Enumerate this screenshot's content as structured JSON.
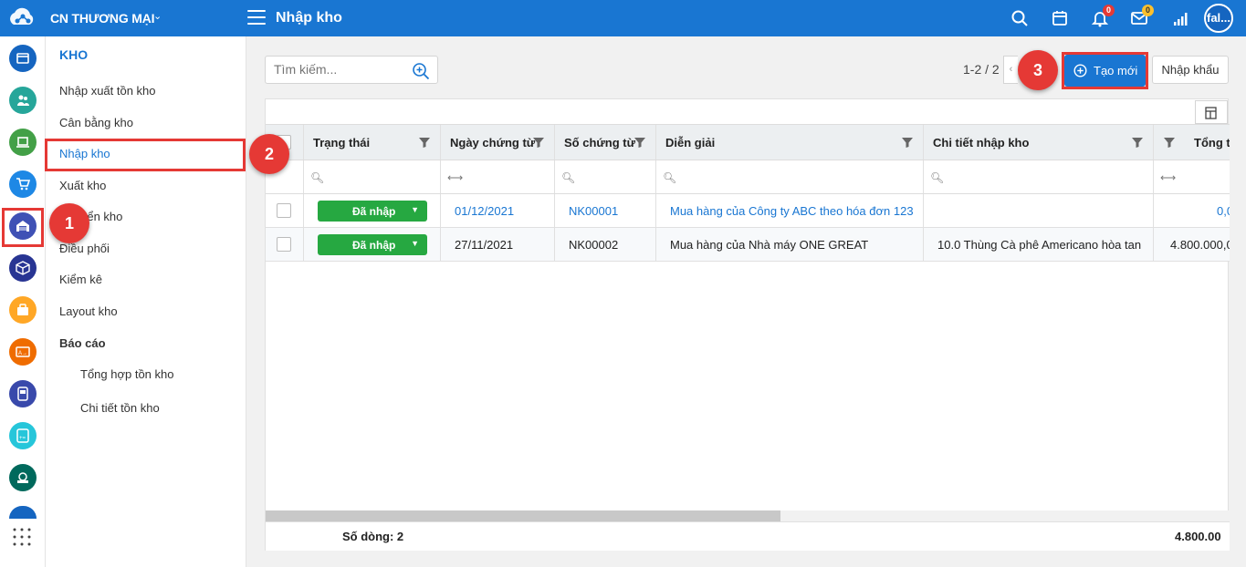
{
  "topbar": {
    "org_name": "CN THƯƠNG MẠI",
    "page_title": "Nhập kho",
    "notif_count": "0",
    "mail_count": "0",
    "avatar_text": "fal..."
  },
  "menu": {
    "header": "KHO",
    "items": [
      {
        "label": "Nhập xuất tồn kho"
      },
      {
        "label": "Cân bằng kho"
      },
      {
        "label": "Nhập kho"
      },
      {
        "label": "Xuất kho"
      },
      {
        "label": "Chuyển kho"
      },
      {
        "label": "Điều phối"
      },
      {
        "label": "Kiểm kê"
      },
      {
        "label": "Layout kho"
      }
    ],
    "report_group": "Báo cáo",
    "report_items": [
      {
        "label": "Tổng hợp tồn kho"
      },
      {
        "label": "Chi tiết tồn kho"
      }
    ]
  },
  "toolbar": {
    "search_placeholder": "Tìm kiếm...",
    "pager_text": "1-2 / 2",
    "new_label": "Tạo mới",
    "import_label": "Nhập khẩu"
  },
  "steps": [
    "1",
    "2",
    "3"
  ],
  "table": {
    "columns": [
      "Trạng thái",
      "Ngày chứng từ",
      "Số chứng từ",
      "Diễn giải",
      "Chi tiết nhập kho",
      "Tổng t"
    ],
    "rows": [
      {
        "status": "Đã nhập",
        "date": "01/12/2021",
        "number": "NK00001",
        "desc": "Mua hàng của Công ty ABC theo hóa đơn 123",
        "detail": "",
        "total": "0,0"
      },
      {
        "status": "Đã nhập",
        "date": "27/11/2021",
        "number": "NK00002",
        "desc": "Mua hàng của Nhà máy ONE GREAT",
        "detail": "10.0 Thùng Cà phê Americano hòa tan",
        "total": "4.800.000,0"
      }
    ],
    "footer_count": "Số dòng: 2",
    "footer_total": "4.800.00"
  },
  "colors": {
    "primary": "#1976d2",
    "status_green": "#26a841",
    "highlight_red": "#e53935"
  }
}
